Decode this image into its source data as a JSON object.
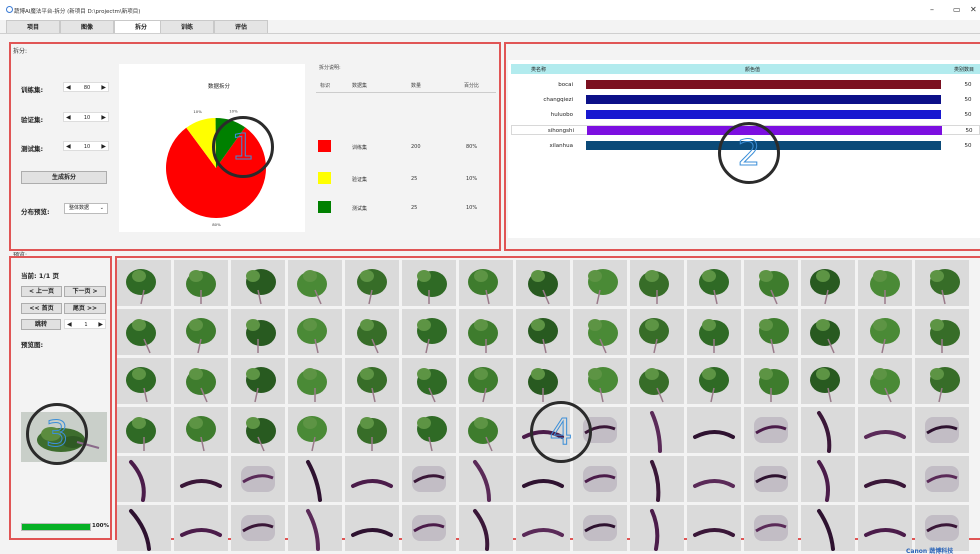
{
  "window": {
    "title": "蔬博AI魔法平台-拆分 (新项目 D:\\projectm\\新项目)",
    "controls": [
      "–",
      "▭",
      "✕"
    ]
  },
  "tabs": [
    {
      "label": "项目",
      "active": false
    },
    {
      "label": "图像",
      "active": false
    },
    {
      "label": "拆分",
      "active": true
    },
    {
      "label": "训练",
      "active": false
    },
    {
      "label": "评估",
      "active": false
    }
  ],
  "split": {
    "section_label": "拆分:",
    "train_label": "训练集:",
    "train_value": "80",
    "val_label": "验证集:",
    "val_value": "10",
    "test_label": "测试集:",
    "test_value": "10",
    "generate_button": "生成拆分",
    "preview_label": "分布预览:",
    "preview_select": "整体数据",
    "chart_title": "数据拆分",
    "legend_title": "拆分说明:",
    "legend_headers": [
      "标识",
      "数据集",
      "数量",
      "百分比"
    ],
    "legend_rows": [
      {
        "color": "#ff0000",
        "name": "训练集",
        "count": "200",
        "percent": "80%"
      },
      {
        "color": "#ffff00",
        "name": "验证集",
        "count": "25",
        "percent": "10%"
      },
      {
        "color": "#008000",
        "name": "测试集",
        "count": "25",
        "percent": "10%"
      }
    ]
  },
  "chart_data": {
    "type": "pie",
    "title": "数据拆分",
    "labels": [
      "训练集",
      "验证集",
      "测试集"
    ],
    "values": [
      80,
      10,
      10
    ],
    "percent_labels": [
      "80%",
      "10%",
      "10%"
    ],
    "colors": [
      "#ff0000",
      "#ffff00",
      "#008000"
    ]
  },
  "classes": {
    "headers": [
      "类名称",
      "颜色值",
      "类别数目"
    ],
    "rows": [
      {
        "name": "bocai",
        "color": "#7b1020",
        "count": "50"
      },
      {
        "name": "changqiezi",
        "color": "#0c1088",
        "count": "50"
      },
      {
        "name": "huluobo",
        "color": "#1818d0",
        "count": "50"
      },
      {
        "name": "sihongshi",
        "color": "#7c0fe0",
        "count": "50"
      },
      {
        "name": "xilanhua",
        "color": "#0b4a78",
        "count": "50"
      }
    ]
  },
  "preview": {
    "section_label": "预览:",
    "page_text": "当前: 1/1 页",
    "prev_button": "< 上一页",
    "next_button": "下一页 >",
    "first_button": "<< 首页",
    "last_button": "尾页 >>",
    "jump_button": "跳转",
    "jump_value": "1",
    "preview_image_label": "预览图:",
    "progress_value": 100,
    "progress_text": "100%"
  },
  "annotations": [
    "1",
    "2",
    "3",
    "4"
  ],
  "footer_brand": "Canon 蔬博科技"
}
